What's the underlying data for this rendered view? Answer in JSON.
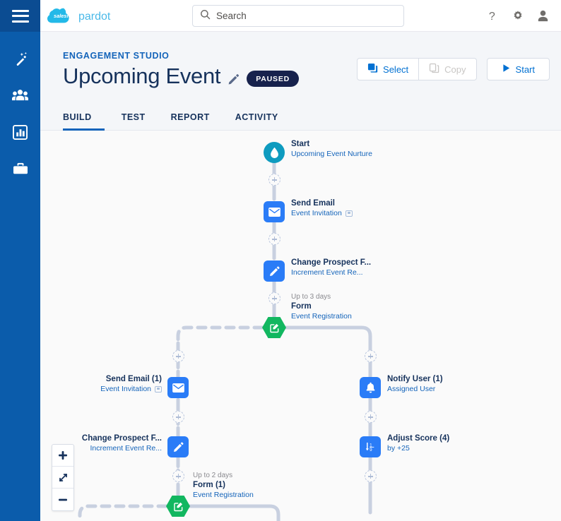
{
  "app": {
    "brand_primary": "salesforce",
    "brand_secondary": "pardot",
    "rail_color": "#0b5cab",
    "accent_blue": "#0070d2",
    "node_blue": "#2a7cf7",
    "node_green": "#12b760",
    "node_teal": "#0e9bbf",
    "title_navy": "#16325c"
  },
  "rail": {
    "menu_label": "menu",
    "items": [
      {
        "name": "magic-wand",
        "label": "Automations"
      },
      {
        "name": "people",
        "label": "Prospects"
      },
      {
        "name": "bar-chart",
        "label": "Reports"
      },
      {
        "name": "briefcase",
        "label": "Admin"
      }
    ]
  },
  "search": {
    "value": "",
    "placeholder": "Search"
  },
  "top_actions": [
    {
      "name": "help",
      "glyph": "?"
    },
    {
      "name": "setup-gear",
      "glyph": "gear"
    },
    {
      "name": "user-avatar",
      "glyph": "person"
    }
  ],
  "header": {
    "eyebrow": "ENGAGEMENT STUDIO",
    "title": "Upcoming Event",
    "edit_label": "Edit name",
    "status_badge": "PAUSED",
    "buttons": {
      "select": "Select",
      "copy": "Copy",
      "start": "Start"
    }
  },
  "tabs": [
    {
      "label": "BUILD",
      "active": true
    },
    {
      "label": "TEST",
      "active": false
    },
    {
      "label": "REPORT",
      "active": false
    },
    {
      "label": "ACTIVITY",
      "active": false
    }
  ],
  "zoom_controls": [
    {
      "name": "zoom-in",
      "label": "+"
    },
    {
      "name": "zoom-fit",
      "label": "fit"
    },
    {
      "name": "zoom-out",
      "label": "-"
    }
  ],
  "flow": {
    "nodes": [
      {
        "id": "start",
        "type": "start",
        "icon": "water-drop-icon",
        "title": "Start",
        "subtitle": "Upcoming Event Nurture",
        "timing": "",
        "has_attachment": false
      },
      {
        "id": "send-email-1",
        "type": "action",
        "icon": "envelope-icon",
        "title": "Send Email",
        "subtitle": "Event Invitation",
        "timing": "",
        "has_attachment": true
      },
      {
        "id": "change-prospect-field-1",
        "type": "action",
        "icon": "pencil-icon",
        "title": "Change Prospect F...",
        "subtitle": "Increment Event Re...",
        "timing": "",
        "has_attachment": false
      },
      {
        "id": "form-trigger-1",
        "type": "trigger",
        "icon": "form-edit-icon",
        "title": "Form",
        "subtitle": "Event Registration",
        "timing": "Up to 3 days",
        "has_attachment": false
      },
      {
        "id": "send-email-branch-1",
        "type": "action",
        "icon": "envelope-icon",
        "title": "Send Email (1)",
        "subtitle": "Event Invitation",
        "timing": "",
        "has_attachment": true
      },
      {
        "id": "change-prospect-field-branch-1",
        "type": "action",
        "icon": "pencil-icon",
        "title": "Change Prospect F...",
        "subtitle": "Increment Event Re...",
        "timing": "",
        "has_attachment": false
      },
      {
        "id": "form-trigger-2",
        "type": "trigger",
        "icon": "form-edit-icon",
        "title": "Form (1)",
        "subtitle": "Event Registration",
        "timing": "Up to 2 days",
        "has_attachment": false
      },
      {
        "id": "notify-user-1",
        "type": "action",
        "icon": "bell-icon",
        "title": "Notify User (1)",
        "subtitle": "Assigned User",
        "timing": "",
        "has_attachment": false
      },
      {
        "id": "adjust-score-4",
        "type": "action",
        "icon": "score-sort-icon",
        "title": "Adjust Score (4)",
        "subtitle": "by +25",
        "timing": "",
        "has_attachment": false
      }
    ]
  }
}
